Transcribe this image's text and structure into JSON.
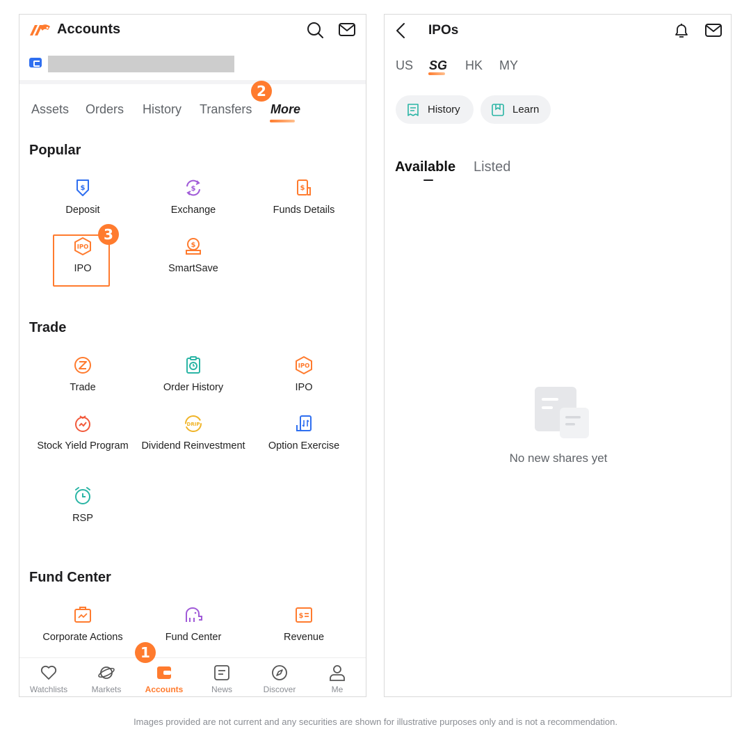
{
  "left_screen": {
    "header": {
      "title": "Accounts",
      "logo": "moomoo-brand-logo",
      "icons": [
        "search-icon",
        "mail-icon"
      ]
    },
    "account": {
      "badge_icon": "account-card-icon",
      "number_masked": true
    },
    "tabs": [
      {
        "label": "Assets",
        "active": false
      },
      {
        "label": "Orders",
        "active": false
      },
      {
        "label": "History",
        "active": false
      },
      {
        "label": "Transfers",
        "active": false
      },
      {
        "label": "More",
        "active": true
      }
    ],
    "sections": [
      {
        "title": "Popular",
        "items": [
          {
            "label": "Deposit",
            "icon": "deposit-icon"
          },
          {
            "label": "Exchange",
            "icon": "exchange-icon"
          },
          {
            "label": "Funds Details",
            "icon": "funds-details-icon"
          },
          {
            "label": "IPO",
            "icon": "ipo-icon",
            "highlighted": true
          },
          {
            "label": "SmartSave",
            "icon": "smartsave-icon"
          }
        ]
      },
      {
        "title": "Trade",
        "items": [
          {
            "label": "Trade",
            "icon": "trade-icon"
          },
          {
            "label": "Order History",
            "icon": "order-history-icon"
          },
          {
            "label": "IPO",
            "icon": "ipo-icon"
          },
          {
            "label": "Stock Yield Program",
            "icon": "stock-yield-icon"
          },
          {
            "label": "Dividend Reinvestment",
            "icon": "drip-icon"
          },
          {
            "label": "Option Exercise",
            "icon": "option-exercise-icon"
          },
          {
            "label": "RSP",
            "icon": "rsp-alarm-icon"
          }
        ]
      },
      {
        "title": "Fund Center",
        "items": [
          {
            "label": "Corporate Actions",
            "icon": "corporate-actions-icon"
          },
          {
            "label": "Fund Center",
            "icon": "fund-center-icon"
          },
          {
            "label": "Revenue",
            "icon": "revenue-icon"
          }
        ]
      }
    ],
    "bottom_nav": [
      {
        "label": "Watchlists",
        "icon": "heart-icon",
        "active": false
      },
      {
        "label": "Markets",
        "icon": "planet-icon",
        "active": false
      },
      {
        "label": "Accounts",
        "icon": "wallet-icon",
        "active": true
      },
      {
        "label": "News",
        "icon": "news-icon",
        "active": false
      },
      {
        "label": "Discover",
        "icon": "compass-icon",
        "active": false
      },
      {
        "label": "Me",
        "icon": "person-icon",
        "active": false
      }
    ]
  },
  "right_screen": {
    "header": {
      "title": "IPOs",
      "icons": [
        "back-icon",
        "bell-icon",
        "mail-icon"
      ]
    },
    "markets": [
      {
        "label": "US",
        "active": false
      },
      {
        "label": "SG",
        "active": true
      },
      {
        "label": "HK",
        "active": false
      },
      {
        "label": "MY",
        "active": false
      }
    ],
    "pills": [
      {
        "label": "History",
        "icon": "history-doc-icon"
      },
      {
        "label": "Learn",
        "icon": "bookmark-icon"
      }
    ],
    "sub_tabs": [
      {
        "label": "Available",
        "active": true
      },
      {
        "label": "Listed",
        "active": false
      }
    ],
    "empty_state": "No new shares yet"
  },
  "callouts": [
    "1",
    "2",
    "3"
  ],
  "disclaimer": "Images provided are not current and any securities are shown for illustrative purposes only and is not a recommendation.",
  "colors": {
    "accent": "#ff7b2e",
    "blue": "#2f6ff0",
    "purple": "#a05ad8",
    "teal": "#2bb5a5",
    "yellow": "#f0b428"
  }
}
